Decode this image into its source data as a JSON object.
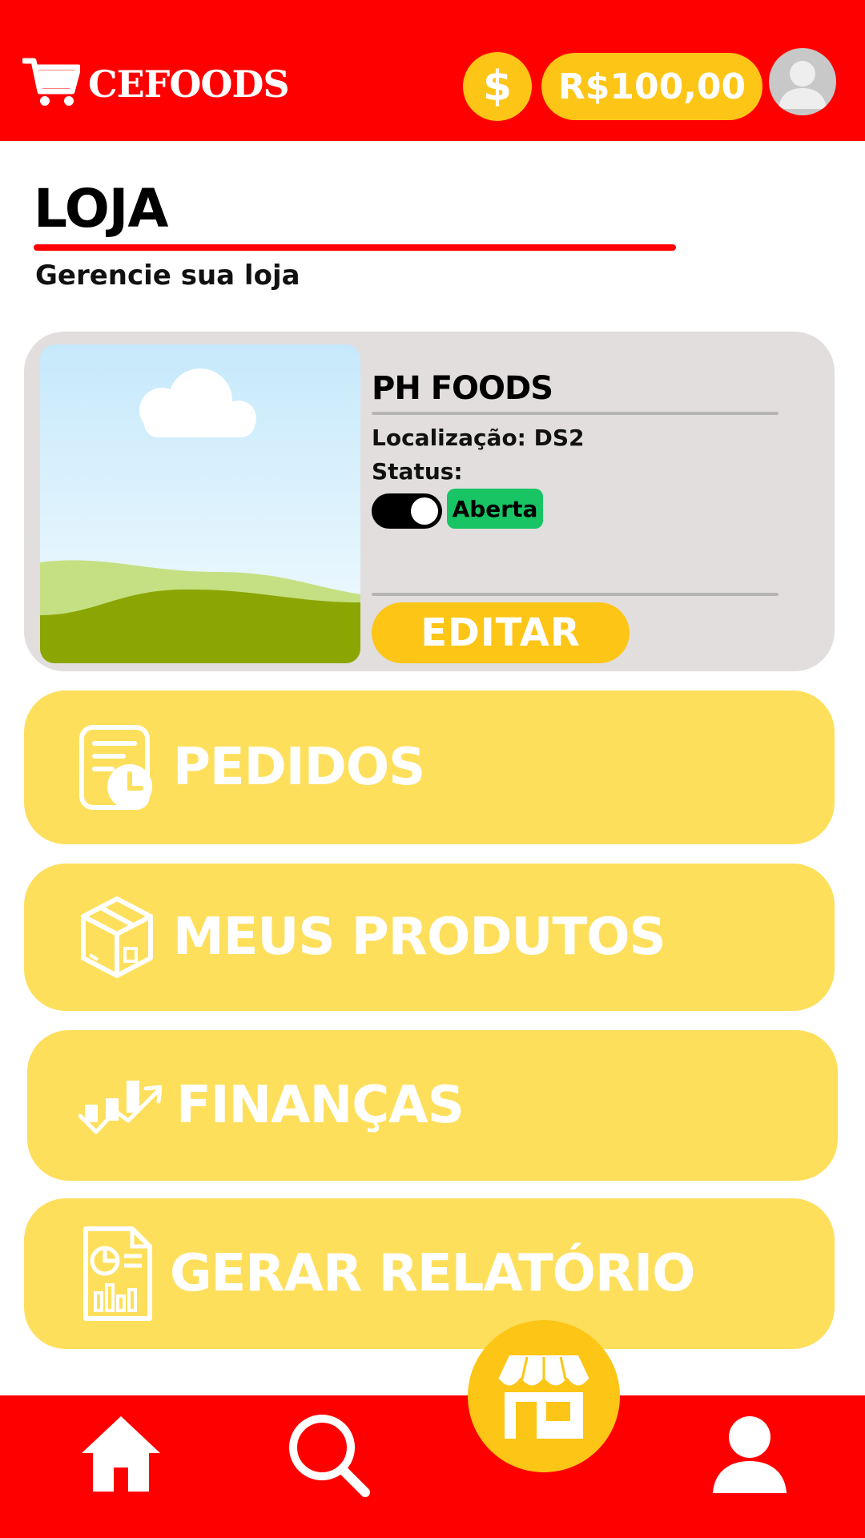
{
  "app": {
    "logo_text": "CEFOODS",
    "currency_symbol": "$",
    "balance": "R$100,00"
  },
  "header": {
    "title": "LOJA",
    "subtitle": "Gerencie sua loja"
  },
  "store": {
    "name": "PH FOODS",
    "location": "Localização: DS2",
    "status_label": "Status:",
    "status_value": "Aberta",
    "status_toggle_on": true,
    "edit_label": "EDITAR"
  },
  "menu": [
    {
      "label": "PEDIDOS",
      "icon": "orders-icon"
    },
    {
      "label": "MEUS PRODUTOS",
      "icon": "box-icon"
    },
    {
      "label": "FINANÇAS",
      "icon": "finance-chart-icon"
    },
    {
      "label": "GERAR RELATÓRIO",
      "icon": "report-icon"
    }
  ],
  "bottom_nav": [
    {
      "icon": "home-icon"
    },
    {
      "icon": "search-icon"
    },
    {
      "icon": "store-icon",
      "active": true
    },
    {
      "icon": "profile-icon"
    }
  ],
  "colors": {
    "primary_red": "#ff0000",
    "accent_yellow": "#fdc515",
    "card_yellow": "#fedf5c",
    "card_gray": "#e1dedd",
    "status_green": "#18c464"
  }
}
